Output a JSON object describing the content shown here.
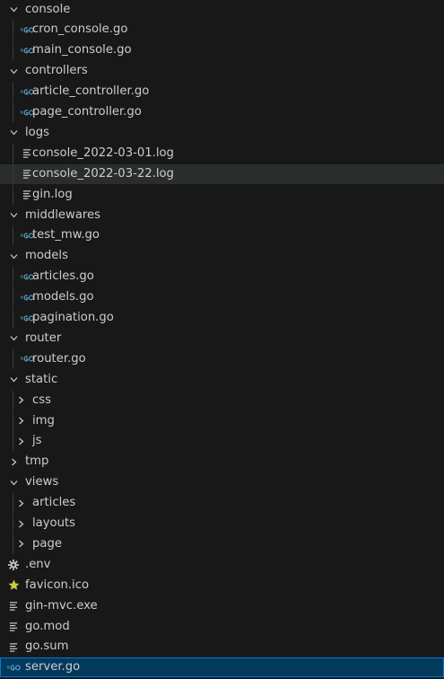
{
  "theme": {
    "background": "#181818",
    "text": "#cccccc",
    "go_icon_color": "#519aba",
    "favicon_icon_color": "#cbcb41",
    "hover_background": "#2a2d2e",
    "selected_background": "#04395e",
    "selected_border": "#0078d4"
  },
  "tree": [
    {
      "label": "console",
      "kind": "folder",
      "depth": 0,
      "expanded": true
    },
    {
      "label": "cron_console.go",
      "kind": "file",
      "icon": "go-icon",
      "depth": 1
    },
    {
      "label": "main_console.go",
      "kind": "file",
      "icon": "go-icon",
      "depth": 1
    },
    {
      "label": "controllers",
      "kind": "folder",
      "depth": 0,
      "expanded": true
    },
    {
      "label": "article_controller.go",
      "kind": "file",
      "icon": "go-icon",
      "depth": 1
    },
    {
      "label": "page_controller.go",
      "kind": "file",
      "icon": "go-icon",
      "depth": 1
    },
    {
      "label": "logs",
      "kind": "folder",
      "depth": 0,
      "expanded": true
    },
    {
      "label": "console_2022-03-01.log",
      "kind": "file",
      "icon": "lines-icon",
      "depth": 1
    },
    {
      "label": "console_2022-03-22.log",
      "kind": "file",
      "icon": "lines-icon",
      "depth": 1,
      "state": "hover"
    },
    {
      "label": "gin.log",
      "kind": "file",
      "icon": "lines-icon",
      "depth": 1
    },
    {
      "label": "middlewares",
      "kind": "folder",
      "depth": 0,
      "expanded": true
    },
    {
      "label": "test_mw.go",
      "kind": "file",
      "icon": "go-icon",
      "depth": 1
    },
    {
      "label": "models",
      "kind": "folder",
      "depth": 0,
      "expanded": true
    },
    {
      "label": "articles.go",
      "kind": "file",
      "icon": "go-icon",
      "depth": 1
    },
    {
      "label": "models.go",
      "kind": "file",
      "icon": "go-icon",
      "depth": 1
    },
    {
      "label": "pagination.go",
      "kind": "file",
      "icon": "go-icon",
      "depth": 1
    },
    {
      "label": "router",
      "kind": "folder",
      "depth": 0,
      "expanded": true
    },
    {
      "label": "router.go",
      "kind": "file",
      "icon": "go-icon",
      "depth": 1
    },
    {
      "label": "static",
      "kind": "folder",
      "depth": 0,
      "expanded": true
    },
    {
      "label": "css",
      "kind": "folder",
      "depth": 1,
      "expanded": false
    },
    {
      "label": "img",
      "kind": "folder",
      "depth": 1,
      "expanded": false
    },
    {
      "label": "js",
      "kind": "folder",
      "depth": 1,
      "expanded": false
    },
    {
      "label": "tmp",
      "kind": "folder",
      "depth": 0,
      "expanded": false
    },
    {
      "label": "views",
      "kind": "folder",
      "depth": 0,
      "expanded": true
    },
    {
      "label": "articles",
      "kind": "folder",
      "depth": 1,
      "expanded": false
    },
    {
      "label": "layouts",
      "kind": "folder",
      "depth": 1,
      "expanded": false
    },
    {
      "label": "page",
      "kind": "folder",
      "depth": 1,
      "expanded": false
    },
    {
      "label": ".env",
      "kind": "file",
      "icon": "gear-icon",
      "depth": 0
    },
    {
      "label": "favicon.ico",
      "kind": "file",
      "icon": "star-icon",
      "depth": 0
    },
    {
      "label": "gin-mvc.exe",
      "kind": "file",
      "icon": "lines-icon",
      "depth": 0
    },
    {
      "label": "go.mod",
      "kind": "file",
      "icon": "lines-icon",
      "depth": 0
    },
    {
      "label": "go.sum",
      "kind": "file",
      "icon": "lines-icon",
      "depth": 0
    },
    {
      "label": "server.go",
      "kind": "file",
      "icon": "go-icon",
      "depth": 0,
      "state": "selected"
    }
  ]
}
